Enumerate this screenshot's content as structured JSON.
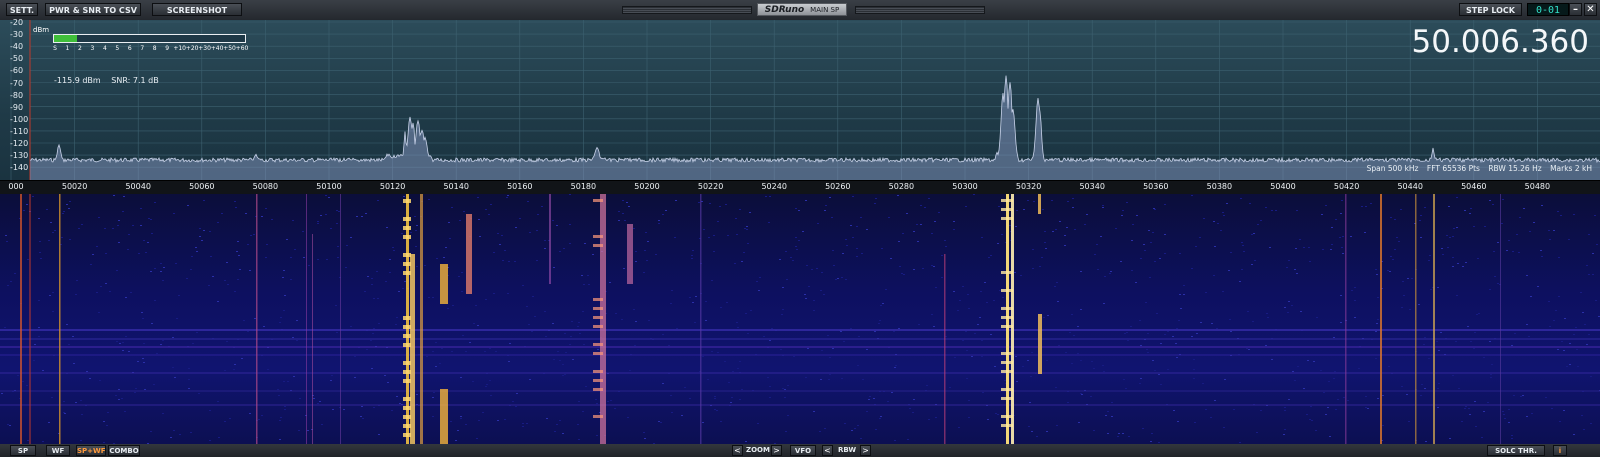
{
  "toolbar": {
    "sett": "SETT.",
    "pwr_snr": "PWR & SNR TO CSV",
    "screenshot": "SCREENSHOT",
    "brand": "SDRuno",
    "panel": "MAIN SP",
    "step_lock": "STEP LOCK",
    "step_digits": "0-01",
    "minimize": "–",
    "close": "✕"
  },
  "spectrum": {
    "y_labels": [
      "-20",
      "-30",
      "-40",
      "-50",
      "-60",
      "-70",
      "-80",
      "-90",
      "-100",
      "-110",
      "-120",
      "-130",
      "-140"
    ],
    "dbm_label": "dBm",
    "smeter_scale": [
      "S",
      "1",
      "2",
      "3",
      "4",
      "5",
      "6",
      "7",
      "8",
      "9",
      "+10",
      "+20",
      "+30",
      "+40",
      "+50",
      "+60"
    ],
    "smeter_level": 0.12,
    "power": "-115.9 dBm",
    "snr": "SNR: 7.1 dB",
    "frequency": "50.006.360",
    "span": "Span 500 kHz",
    "fft": "FFT 65536 Pts",
    "rbw": "RBW 15.26 Hz",
    "marks": "Marks 2 kH"
  },
  "freq_axis": {
    "labels": [
      "000",
      "50020",
      "50040",
      "50060",
      "50080",
      "50100",
      "50120",
      "50140",
      "50160",
      "50180",
      "50200",
      "50220",
      "50240",
      "50260",
      "50280",
      "50300",
      "50320",
      "50340",
      "50360",
      "50380",
      "50400",
      "50420",
      "50440",
      "50460",
      "50480"
    ]
  },
  "colors": {
    "spectrum_bg": "#244452",
    "trace": "#c9d3ea",
    "waterfall_bg": "#0d1060",
    "meter_fill": "#3fbf3a",
    "active_mode": "#ff9a3c"
  },
  "bottombar": {
    "sp": "SP",
    "wf": "WF",
    "spwf": "SP+WF",
    "combo": "COMBO",
    "zoom": "ZOOM",
    "vfo": "VFO",
    "rbw": "RBW",
    "solc": "SOLC THR.",
    "prev": "<",
    "next": ">"
  }
}
